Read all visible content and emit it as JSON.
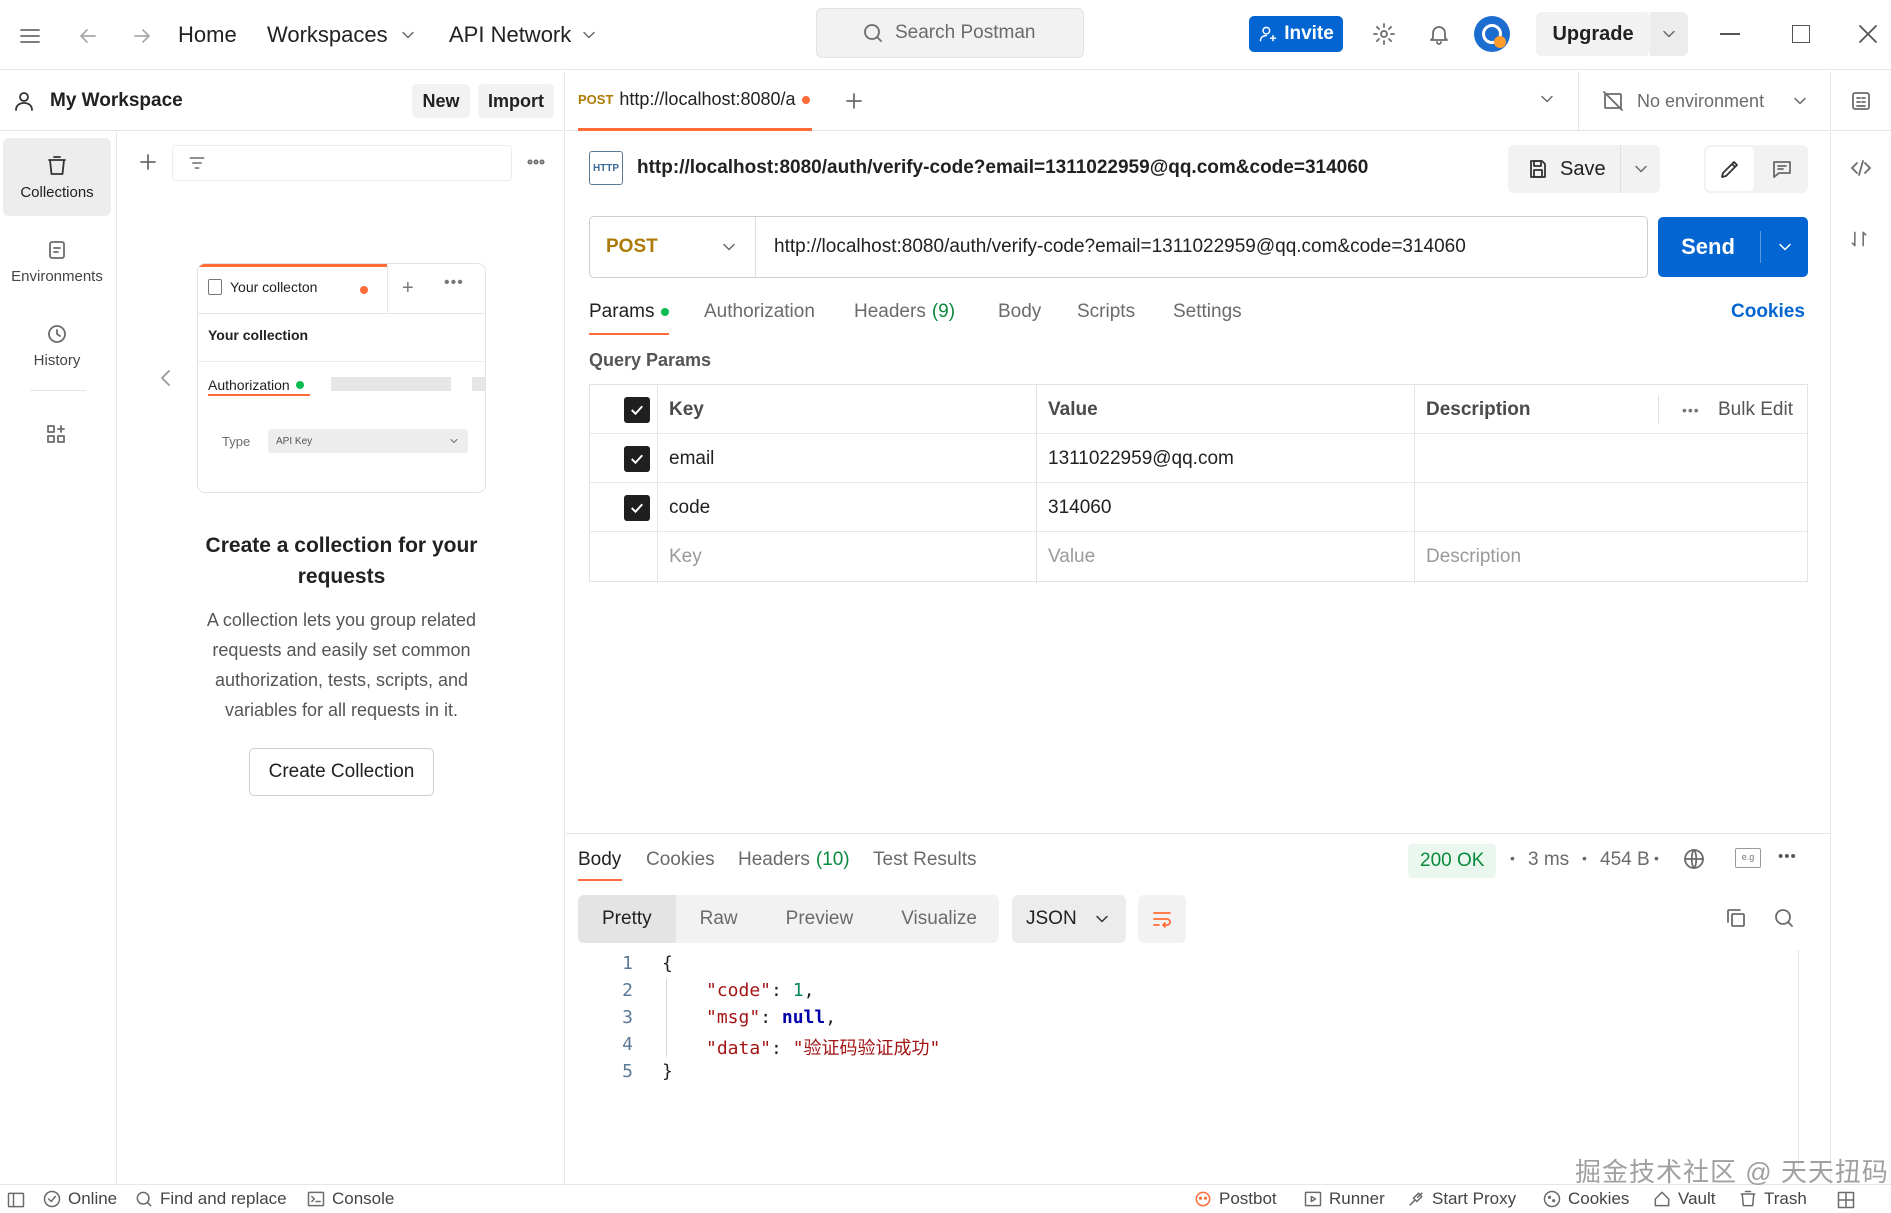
{
  "topbar": {
    "home": "Home",
    "workspaces": "Workspaces",
    "api_network": "API Network",
    "search_placeholder": "Search Postman",
    "invite": "Invite",
    "upgrade": "Upgrade"
  },
  "workspace": {
    "name": "My Workspace",
    "new_btn": "New",
    "import_btn": "Import"
  },
  "rail": {
    "collections": "Collections",
    "environments": "Environments",
    "history": "History"
  },
  "sidebar": {
    "card": {
      "tab_label": "Your collecton",
      "title": "Your collection",
      "auth_label": "Authorization",
      "type_label": "Type",
      "type_value": "API Key"
    },
    "empty_title": "Create a collection for your requests",
    "empty_desc": "A collection lets you group related requests and easily set common authorization, tests, scripts, and variables for all requests in it.",
    "create_btn": "Create Collection"
  },
  "tabs": {
    "active": {
      "method": "POST",
      "title": "http://localhost:8080/a"
    },
    "environment": "No environment"
  },
  "request": {
    "title": "http://localhost:8080/auth/verify-code?email=1311022959@qq.com&code=314060",
    "protocol_badge": "HTTP",
    "save": "Save",
    "method": "POST",
    "url": "http://localhost:8080/auth/verify-code?email=1311022959@qq.com&code=314060",
    "send": "Send",
    "tabs": {
      "params": "Params",
      "authorization": "Authorization",
      "headers": "Headers",
      "headers_count": "(9)",
      "body": "Body",
      "scripts": "Scripts",
      "settings": "Settings",
      "cookies": "Cookies"
    },
    "query_params_title": "Query Params",
    "table": {
      "col_key": "Key",
      "col_value": "Value",
      "col_description": "Description",
      "bulk_edit": "Bulk Edit",
      "rows": [
        {
          "key": "email",
          "value": "1311022959@qq.com",
          "checked": true
        },
        {
          "key": "code",
          "value": "314060",
          "checked": true
        }
      ],
      "placeholder_key": "Key",
      "placeholder_value": "Value",
      "placeholder_description": "Description"
    }
  },
  "response": {
    "tabs": {
      "body": "Body",
      "cookies": "Cookies",
      "headers": "Headers",
      "headers_count": "(10)",
      "test_results": "Test Results"
    },
    "status": "200 OK",
    "time": "3 ms",
    "size": "454 B",
    "formats": [
      "Pretty",
      "Raw",
      "Preview",
      "Visualize"
    ],
    "language": "JSON",
    "body_lines": [
      {
        "n": "1",
        "text": "{"
      },
      {
        "n": "2",
        "key": "\"code\"",
        "val": "1",
        "val_type": "number",
        "comma": ","
      },
      {
        "n": "3",
        "key": "\"msg\"",
        "val": "null",
        "val_type": "keyword",
        "comma": ","
      },
      {
        "n": "4",
        "key": "\"data\"",
        "val": "\"验证码验证成功\"",
        "val_type": "string",
        "comma": ""
      },
      {
        "n": "5",
        "text": "}"
      }
    ]
  },
  "statusbar": {
    "online": "Online",
    "find_replace": "Find and replace",
    "console": "Console",
    "postbot": "Postbot",
    "runner": "Runner",
    "start_proxy": "Start Proxy",
    "cookies": "Cookies",
    "vault": "Vault",
    "trash": "Trash"
  },
  "watermark": "掘金技术社区 @ 天天扭码",
  "colors": {
    "accent_blue": "#0265d2",
    "orange": "#ff6c37",
    "post_method": "#ad7a03",
    "ok_green": "#0a8a3e"
  }
}
